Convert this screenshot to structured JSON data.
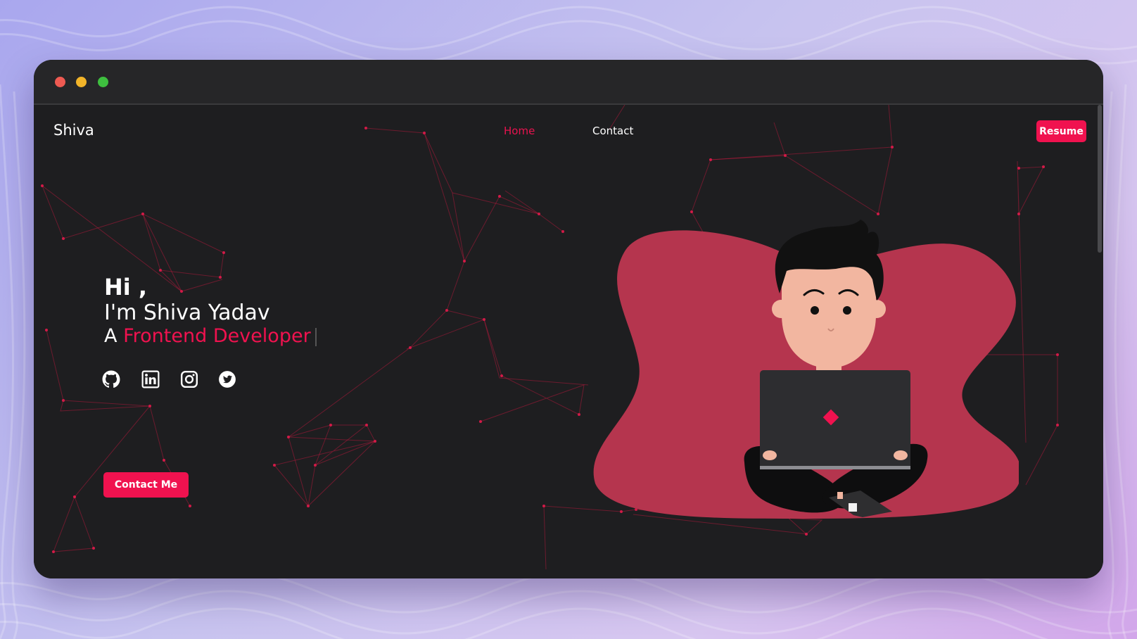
{
  "colors": {
    "accent": "#f0124f",
    "window_bg": "#1e1e20",
    "titlebar_bg": "#262628",
    "traffic_red": "#ee5a52",
    "traffic_yellow": "#f2b429",
    "traffic_green": "#3ebf3f",
    "blob": "#b5354e"
  },
  "navbar": {
    "logo": "Shiva",
    "links": [
      {
        "label": "Home",
        "active": true
      },
      {
        "label": "Contact",
        "active": false
      }
    ],
    "resume_label": "Resume"
  },
  "hero": {
    "greeting": "Hi ,",
    "name_line": "I'm Shiva Yadav",
    "role_prefix": "A",
    "role": "Frontend Developer",
    "social_icons": [
      "github-icon",
      "linkedin-icon",
      "instagram-icon",
      "twitter-icon"
    ],
    "cta_label": "Contact Me"
  },
  "illustration": {
    "icon": "developer-with-laptop-illustration"
  }
}
